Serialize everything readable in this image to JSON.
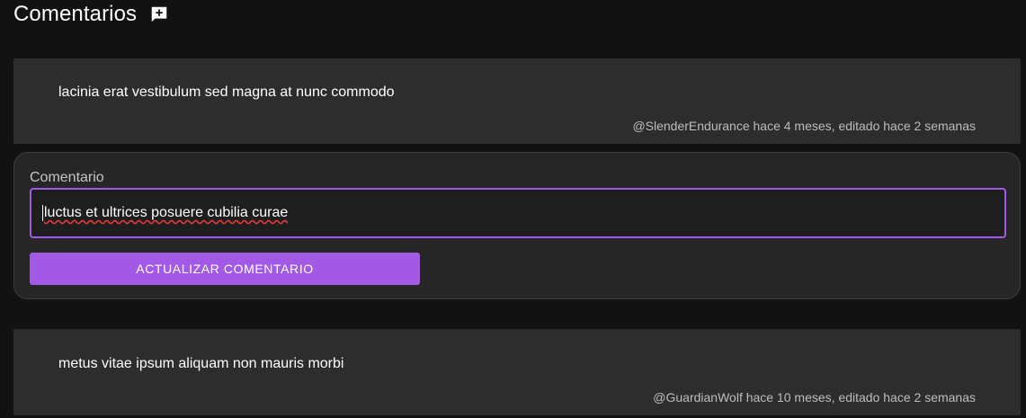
{
  "header": {
    "title": "Comentarios",
    "add_icon": "add-comment-icon"
  },
  "comments": [
    {
      "text": "lacinia erat vestibulum sed magna at nunc commodo",
      "meta": "@SlenderEndurance hace 4 meses, editado hace 2 semanas"
    },
    {
      "text": "metus vitae ipsum aliquam non mauris morbi",
      "meta": "@GuardianWolf hace 10 meses, editado hace 2 semanas"
    }
  ],
  "edit_form": {
    "label": "Comentario",
    "value": "luctus et ultrices posuere cubilia curae",
    "submit_label": "ACTUALIZAR COMENTARIO"
  },
  "colors": {
    "background": "#121212",
    "card": "#2d2d2d",
    "accent": "#a259e6"
  }
}
